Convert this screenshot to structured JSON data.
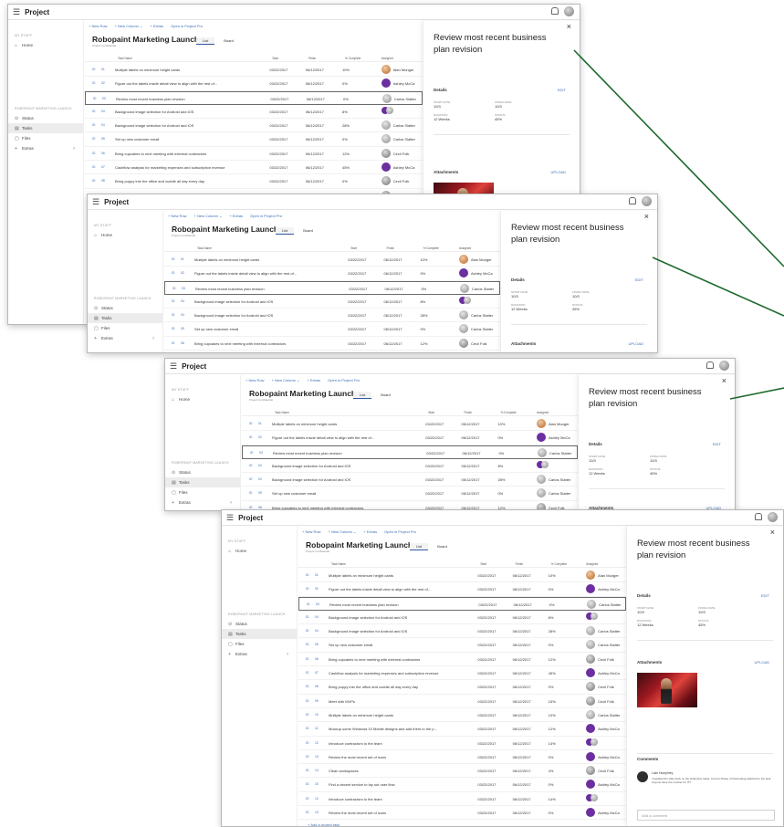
{
  "app": {
    "title": "Project",
    "menu_icon": "hamburger-icon",
    "notification_icon": "bell-icon",
    "avatar_icon": "user-avatar-icon"
  },
  "sidebar": {
    "section_my_stuff": "MY STUFF",
    "home": "Home",
    "section_project": "ROBOPAINT MARKETING LAUNCH",
    "status": "Status",
    "tasks": "Tasks",
    "files": "Files",
    "extras": "Extras"
  },
  "commands": {
    "new_row": "+ New Row",
    "new_column": "+ New Column ⌄",
    "extras": "+ Extras",
    "open_in_pro": "Open in Project Pro",
    "gantt": "Gantt",
    "filter": "Filter ⌄",
    "share": "Share"
  },
  "project": {
    "title": "Robopaint Marketing Launch",
    "subtitle": "Project Confidential",
    "tab_list": "List",
    "tab_board": "Board"
  },
  "columns": {
    "task_name": "Task Name",
    "start": "Start",
    "finish": "Finish",
    "percent": "% Complete",
    "assigned": "Assigned"
  },
  "tasks": [
    {
      "code": "ID",
      "id": "01",
      "name": "Multiple labels on minimum height cards",
      "start": "03/22/2017",
      "finish": "06/12/2017",
      "pct": "10%",
      "assigned": "Alan Munger"
    },
    {
      "code": "ID",
      "id": "02",
      "name": "Figure out the labels inside detail view to align with the rest of...",
      "start": "03/22/2017",
      "finish": "06/12/2017",
      "pct": "0%",
      "assigned": "Ashley McCa"
    },
    {
      "code": "ID",
      "id": "03",
      "name": "Review most recent business plan revision",
      "start": "03/22/2017",
      "finish": "06/12/2017",
      "pct": "0%",
      "assigned": "Carlos Slatter"
    },
    {
      "code": "ID",
      "id": "04",
      "name": "Background image selection for Android and iOS",
      "start": "03/22/2017",
      "finish": "06/12/2017",
      "pct": "8%",
      "assigned": ""
    },
    {
      "code": "ID",
      "id": "04",
      "name": "Background image selection for Android and iOS",
      "start": "03/22/2017",
      "finish": "06/12/2017",
      "pct": "28%",
      "assigned": "Carlos Slatter"
    },
    {
      "code": "ID",
      "id": "05",
      "name": "Set up new customer email",
      "start": "03/22/2017",
      "finish": "06/12/2017",
      "pct": "0%",
      "assigned": "Carlos Slatter"
    },
    {
      "code": "ID",
      "id": "06",
      "name": "Bring cupcakes to next meeting with external contractors",
      "start": "03/22/2017",
      "finish": "06/12/2017",
      "pct": "12%",
      "assigned": "Cecil Folk"
    },
    {
      "code": "ID",
      "id": "07",
      "name": "Cashflow analysis for marketing expenses and subscription revenue",
      "start": "03/22/2017",
      "finish": "06/12/2017",
      "pct": "45%",
      "assigned": "Ashley McCa"
    },
    {
      "code": "ID",
      "id": "08",
      "name": "Bring puppy into the office and cuddle all day every day",
      "start": "03/22/2017",
      "finish": "06/12/2017",
      "pct": "0%",
      "assigned": "Cecil Folk"
    },
    {
      "code": "ID",
      "id": "09",
      "name": "Meet with MVPs",
      "start": "03/22/2017",
      "finish": "06/12/2017",
      "pct": "15%",
      "assigned": "Cecil Folk"
    },
    {
      "code": "ID",
      "id": "10",
      "name": "Multiple labels on minimum height cards",
      "start": "03/22/2017",
      "finish": "06/12/2017",
      "pct": "10%",
      "assigned": "Carlos Slatter"
    },
    {
      "code": "ID",
      "id": "11",
      "name": "Mockup some Windows 10 Mobile designs and add them to the p...",
      "start": "03/22/2017",
      "finish": "06/12/2017",
      "pct": "12%",
      "assigned": "Ashley McCa"
    },
    {
      "code": "ID",
      "id": "12",
      "name": "Introduce contractors to the team",
      "start": "03/22/2017",
      "finish": "06/12/2017",
      "pct": "14%",
      "assigned": ""
    },
    {
      "code": "ID",
      "id": "13",
      "name": "Review the most recent set of icons",
      "start": "03/22/2017",
      "finish": "06/12/2017",
      "pct": "0%",
      "assigned": "Ashley McCa"
    },
    {
      "code": "ID",
      "id": "14",
      "name": "Clean workspaces",
      "start": "03/22/2017",
      "finish": "06/12/2017",
      "pct": "4%",
      "assigned": "Cecil Folk"
    },
    {
      "code": "ID",
      "id": "15",
      "name": "Find a decent service to lay out user flow",
      "start": "03/22/2017",
      "finish": "06/12/2017",
      "pct": "0%",
      "assigned": "Ashley McCa"
    },
    {
      "code": "ID",
      "id": "12",
      "name": "Introduce contractors to the team",
      "start": "03/22/2017",
      "finish": "06/12/2017",
      "pct": "14%",
      "assigned": ""
    },
    {
      "code": "ID",
      "id": "13",
      "name": "Review the most recent set of icons",
      "start": "03/22/2017",
      "finish": "06/12/2017",
      "pct": "0%",
      "assigned": "Ashley McCa"
    }
  ],
  "add_task": "+ Add a project task",
  "panel": {
    "title": "Review most recent business plan revision",
    "details": "Details",
    "edit": "EDIT",
    "start_label": "START DATE",
    "start_value": "10/3",
    "finish_label": "FINISH DATE",
    "finish_value": "10/3",
    "duration_label": "DURATION",
    "duration_value": "12 Weeks",
    "status_label": "STATUS",
    "status_value": "45%",
    "attachments": "Attachments",
    "upload": "UPLOAD",
    "comments": "Comments",
    "comment_author": "Luke Humphrey",
    "comment_text": "I tweaked the slide deck on the slideshow today. Current Phase of flowmaking attached to the task. Anyone have the number for IT?",
    "comment_placeholder": "Add a comment"
  },
  "colors": {
    "accent": "#3b6fb6",
    "callout": "#1e6b2e"
  }
}
